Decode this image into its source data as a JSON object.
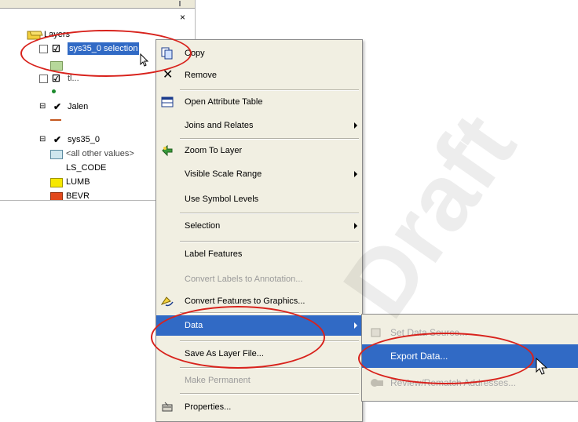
{
  "toc": {
    "close_glyph": "×",
    "layers_root": "Layers",
    "layers": [
      {
        "name": "sys35_0 selection",
        "checked": true
      },
      {
        "name": "tl...",
        "checked": true
      },
      {
        "name": "Jalen",
        "checked": true
      },
      {
        "name": "sys35_0",
        "checked": true
      }
    ],
    "legend": [
      "<all other values>",
      "LS_CODE",
      "LUMB",
      "BEVR"
    ]
  },
  "menu": {
    "items": [
      {
        "label": "Copy",
        "icon": "copy-icon",
        "submenu": false
      },
      {
        "label": "Remove",
        "icon": "remove-x-icon",
        "submenu": false
      },
      {
        "label": "Open Attribute Table",
        "icon": "table-icon",
        "submenu": false
      },
      {
        "label": "Joins and Relates",
        "icon": "",
        "submenu": true
      },
      {
        "label": "Zoom To Layer",
        "icon": "zoom-to-layer-icon",
        "submenu": false
      },
      {
        "label": "Visible Scale Range",
        "icon": "",
        "submenu": true
      },
      {
        "label": "Use Symbol Levels",
        "icon": "",
        "submenu": false
      },
      {
        "label": "Selection",
        "icon": "",
        "submenu": true
      },
      {
        "label": "Label Features",
        "icon": "",
        "submenu": false
      },
      {
        "label": "Convert Labels to Annotation...",
        "icon": "",
        "submenu": false,
        "disabled": true
      },
      {
        "label": "Convert Features to Graphics...",
        "icon": "convert-graphics-icon",
        "submenu": false
      },
      {
        "label": "Data",
        "icon": "",
        "submenu": true,
        "highlighted": true
      },
      {
        "label": "Save As Layer File...",
        "icon": "",
        "submenu": false
      },
      {
        "label": "Make Permanent",
        "icon": "",
        "submenu": false,
        "disabled": true
      },
      {
        "label": "Properties...",
        "icon": "properties-icon",
        "submenu": false
      }
    ]
  },
  "submenu": {
    "items": [
      {
        "label": "Set Data Source...",
        "disabled": true
      },
      {
        "label": "Export Data...",
        "highlighted": true
      },
      {
        "label": "Review/Rematch Addresses...",
        "disabled": true
      }
    ]
  },
  "watermark": "Draft",
  "colors": {
    "highlight": "#316ac5",
    "annotation_ring": "#d8221c",
    "menu_bg": "#f1efe2"
  }
}
